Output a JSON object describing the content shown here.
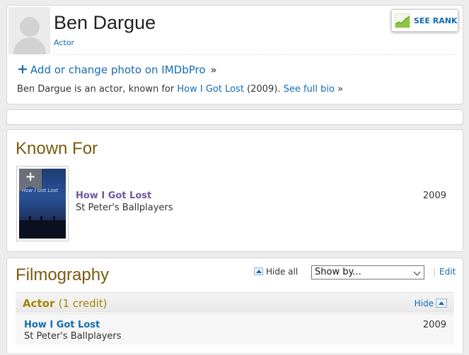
{
  "person": {
    "name": "Ben Dargue",
    "role": "Actor"
  },
  "rank_button": {
    "label": "SEE RANK",
    "icon": "rank-chart-icon"
  },
  "add_photo": {
    "plus": "+",
    "label": "Add or change photo on IMDbPro",
    "raquo": "»"
  },
  "bio": {
    "prefix": "Ben Dargue is an actor, known for ",
    "film": "How I Got Lost",
    "year_text": " (2009). ",
    "see_full": "See full bio",
    "raquo": " »"
  },
  "known_for": {
    "title": "Known For",
    "items": [
      {
        "title": "How I Got Lost",
        "character": "St Peter's Ballplayers",
        "year": "2009",
        "poster_text": "How I Got Lost",
        "add_label": "+"
      }
    ]
  },
  "filmography": {
    "title": "Filmography",
    "hide_all": "Hide all",
    "show_by": "Show by...",
    "edit": "Edit",
    "edit_separator": "|",
    "section": {
      "label": "Actor",
      "count": "(1 credit)",
      "hide": "Hide"
    },
    "rows": [
      {
        "title": "How I Got Lost",
        "character": "St Peter's Ballplayers",
        "year": "2009"
      }
    ]
  },
  "colors": {
    "link": "#136cb2",
    "section_title": "#7a5a10",
    "known_for_title": "#70579d",
    "category_label": "#a58500",
    "rank_chart": "#8dc63f"
  }
}
